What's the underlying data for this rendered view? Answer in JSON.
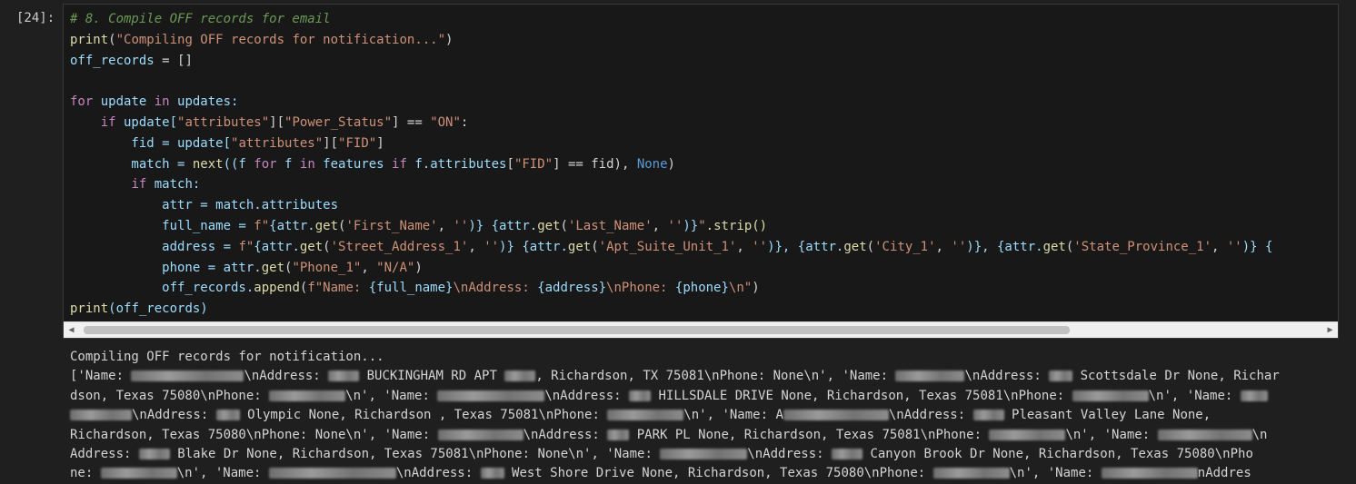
{
  "cell": {
    "prompt": "[24]:",
    "code_lines": [
      [
        {
          "t": "# 8. Compile OFF records for email",
          "c": "cm"
        }
      ],
      [
        {
          "t": "print",
          "c": "fn"
        },
        {
          "t": "(",
          "c": "op"
        },
        {
          "t": "\"Compiling OFF records for notification...\"",
          "c": "str"
        },
        {
          "t": ")",
          "c": "op"
        }
      ],
      [
        {
          "t": "off_records",
          "c": "var"
        },
        {
          "t": " = ",
          "c": "op"
        },
        {
          "t": "[]",
          "c": "op"
        }
      ],
      [
        {
          "t": "",
          "c": "op"
        }
      ],
      [
        {
          "t": "for",
          "c": "kw"
        },
        {
          "t": " update ",
          "c": "var"
        },
        {
          "t": "in",
          "c": "kw"
        },
        {
          "t": " updates:",
          "c": "var"
        }
      ],
      [
        {
          "t": "    ",
          "c": "op"
        },
        {
          "t": "if",
          "c": "kw"
        },
        {
          "t": " update[",
          "c": "var"
        },
        {
          "t": "\"attributes\"",
          "c": "str"
        },
        {
          "t": "][",
          "c": "op"
        },
        {
          "t": "\"Power_Status\"",
          "c": "str"
        },
        {
          "t": "] == ",
          "c": "op"
        },
        {
          "t": "\"ON\"",
          "c": "str"
        },
        {
          "t": ":",
          "c": "op"
        }
      ],
      [
        {
          "t": "        fid = update[",
          "c": "var"
        },
        {
          "t": "\"attributes\"",
          "c": "str"
        },
        {
          "t": "][",
          "c": "op"
        },
        {
          "t": "\"FID\"",
          "c": "str"
        },
        {
          "t": "]",
          "c": "op"
        }
      ],
      [
        {
          "t": "        match = ",
          "c": "var"
        },
        {
          "t": "next",
          "c": "fn"
        },
        {
          "t": "((f ",
          "c": "var"
        },
        {
          "t": "for",
          "c": "kw"
        },
        {
          "t": " f ",
          "c": "var"
        },
        {
          "t": "in",
          "c": "kw"
        },
        {
          "t": " features ",
          "c": "var"
        },
        {
          "t": "if",
          "c": "kw"
        },
        {
          "t": " f.",
          "c": "var"
        },
        {
          "t": "attributes",
          "c": "var"
        },
        {
          "t": "[",
          "c": "op"
        },
        {
          "t": "\"FID\"",
          "c": "str"
        },
        {
          "t": "] == fid), ",
          "c": "op"
        },
        {
          "t": "None",
          "c": "none"
        },
        {
          "t": ")",
          "c": "op"
        }
      ],
      [
        {
          "t": "        ",
          "c": "op"
        },
        {
          "t": "if",
          "c": "kw"
        },
        {
          "t": " match:",
          "c": "var"
        }
      ],
      [
        {
          "t": "            attr = match.",
          "c": "var"
        },
        {
          "t": "attributes",
          "c": "var"
        }
      ],
      [
        {
          "t": "            full_name = ",
          "c": "var"
        },
        {
          "t": "f\"",
          "c": "str"
        },
        {
          "t": "{attr.",
          "c": "var"
        },
        {
          "t": "get",
          "c": "fn"
        },
        {
          "t": "(",
          "c": "op"
        },
        {
          "t": "'First_Name'",
          "c": "str"
        },
        {
          "t": ", ",
          "c": "op"
        },
        {
          "t": "''",
          "c": "str"
        },
        {
          "t": ")} {attr.",
          "c": "var"
        },
        {
          "t": "get",
          "c": "fn"
        },
        {
          "t": "(",
          "c": "op"
        },
        {
          "t": "'Last_Name'",
          "c": "str"
        },
        {
          "t": ", ",
          "c": "op"
        },
        {
          "t": "''",
          "c": "str"
        },
        {
          "t": ")}",
          "c": "var"
        },
        {
          "t": "\"",
          "c": "str"
        },
        {
          "t": ".strip()",
          "c": "fn"
        }
      ],
      [
        {
          "t": "            address = ",
          "c": "var"
        },
        {
          "t": "f\"",
          "c": "str"
        },
        {
          "t": "{attr.",
          "c": "var"
        },
        {
          "t": "get",
          "c": "fn"
        },
        {
          "t": "(",
          "c": "op"
        },
        {
          "t": "'Street_Address_1'",
          "c": "str"
        },
        {
          "t": ", ",
          "c": "op"
        },
        {
          "t": "''",
          "c": "str"
        },
        {
          "t": ")} {attr.",
          "c": "var"
        },
        {
          "t": "get",
          "c": "fn"
        },
        {
          "t": "(",
          "c": "op"
        },
        {
          "t": "'Apt_Suite_Unit_1'",
          "c": "str"
        },
        {
          "t": ", ",
          "c": "op"
        },
        {
          "t": "''",
          "c": "str"
        },
        {
          "t": ")}, {attr.",
          "c": "var"
        },
        {
          "t": "get",
          "c": "fn"
        },
        {
          "t": "(",
          "c": "op"
        },
        {
          "t": "'City_1'",
          "c": "str"
        },
        {
          "t": ", ",
          "c": "op"
        },
        {
          "t": "''",
          "c": "str"
        },
        {
          "t": ")}, {attr.",
          "c": "var"
        },
        {
          "t": "get",
          "c": "fn"
        },
        {
          "t": "(",
          "c": "op"
        },
        {
          "t": "'State_Province_1'",
          "c": "str"
        },
        {
          "t": ", ",
          "c": "op"
        },
        {
          "t": "''",
          "c": "str"
        },
        {
          "t": ")} {",
          "c": "var"
        }
      ],
      [
        {
          "t": "            phone = attr.",
          "c": "var"
        },
        {
          "t": "get",
          "c": "fn"
        },
        {
          "t": "(",
          "c": "op"
        },
        {
          "t": "\"Phone_1\"",
          "c": "str"
        },
        {
          "t": ", ",
          "c": "op"
        },
        {
          "t": "\"N/A\"",
          "c": "str"
        },
        {
          "t": ")",
          "c": "op"
        }
      ],
      [
        {
          "t": "            off_records.",
          "c": "var"
        },
        {
          "t": "append",
          "c": "fn"
        },
        {
          "t": "(",
          "c": "op"
        },
        {
          "t": "f\"Name: ",
          "c": "str"
        },
        {
          "t": "{full_name}",
          "c": "var"
        },
        {
          "t": "\\nAddress: ",
          "c": "str"
        },
        {
          "t": "{address}",
          "c": "var"
        },
        {
          "t": "\\nPhone: ",
          "c": "str"
        },
        {
          "t": "{phone}",
          "c": "var"
        },
        {
          "t": "\\n\"",
          "c": "str"
        },
        {
          "t": ")",
          "c": "op"
        }
      ],
      [
        {
          "t": "print",
          "c": "fn"
        },
        {
          "t": "(off_records)",
          "c": "var"
        }
      ]
    ]
  },
  "output": {
    "lines": [
      [
        {
          "t": "Compiling OFF records for notification..."
        }
      ],
      [
        {
          "t": "['Name: "
        },
        {
          "b": 124
        },
        {
          "t": "\\nAddress: "
        },
        {
          "b": 34
        },
        {
          "t": " BUCKINGHAM RD APT "
        },
        {
          "b": 34
        },
        {
          "t": ", Richardson, TX 75081\\nPhone: None\\n', 'Name: "
        },
        {
          "b": 76
        },
        {
          "t": "\\nAddress: "
        },
        {
          "b": 26
        },
        {
          "t": " Scottsdale Dr None, Richar"
        }
      ],
      [
        {
          "t": "dson, Texas 75080\\nPhone: "
        },
        {
          "b": 84
        },
        {
          "t": "\\n', 'Name: "
        },
        {
          "b": 118
        },
        {
          "t": "\\nAddress: "
        },
        {
          "b": 24
        },
        {
          "t": " HILLSDALE DRIVE None, Richardson, Texas 75081\\nPhone: "
        },
        {
          "b": 84
        },
        {
          "t": "\\n', 'Name: "
        },
        {
          "b": 30
        }
      ],
      [
        {
          "b": 68
        },
        {
          "t": "\\nAddress: "
        },
        {
          "b": 26
        },
        {
          "t": " Olympic None, Richardson , Texas 75081\\nPhone: "
        },
        {
          "b": 84
        },
        {
          "t": "\\n', 'Name: A"
        },
        {
          "b": 116
        },
        {
          "t": "\\nAddress: "
        },
        {
          "b": 34
        },
        {
          "t": " Pleasant Valley Lane None,"
        }
      ],
      [
        {
          "t": "Richardson, Texas 75080\\nPhone: None\\n', 'Name: "
        },
        {
          "b": 94
        },
        {
          "t": "\\nAddress: "
        },
        {
          "b": 24
        },
        {
          "t": " PARK PL None, Richardson, Texas 75081\\nPhone: "
        },
        {
          "b": 84
        },
        {
          "t": "\\n', 'Name: "
        },
        {
          "b": 104
        },
        {
          "t": "\\n"
        }
      ],
      [
        {
          "t": "Address: "
        },
        {
          "b": 34
        },
        {
          "t": " Blake Dr None, Richardson, Texas 75081\\nPhone: None\\n', 'Name: "
        },
        {
          "b": 96
        },
        {
          "t": "\\nAddress: "
        },
        {
          "b": 34
        },
        {
          "t": " Canyon Brook Dr None, Richardson, Texas 75080\\nPho"
        }
      ],
      [
        {
          "t": "ne: "
        },
        {
          "b": 84
        },
        {
          "t": "\\n', 'Name: "
        },
        {
          "b": 140
        },
        {
          "t": "\\nAddress: "
        },
        {
          "b": 26
        },
        {
          "t": " West Shore Drive None, Richardson, Texas 75080\\nPhone: "
        },
        {
          "b": 84
        },
        {
          "t": "\\n', 'Name: "
        },
        {
          "b": 106
        },
        {
          "t": "nAddres"
        }
      ]
    ]
  },
  "colors": {
    "background": "#1f1f1f",
    "cell_background": "#181818",
    "keyword": "#c586c0",
    "string": "#ce9178",
    "function": "#dcdcaa",
    "variable": "#9cdcfe",
    "comment": "#6a9955"
  },
  "icons": {
    "scroll_left": "triangle-left-icon",
    "scroll_right": "triangle-right-icon"
  }
}
